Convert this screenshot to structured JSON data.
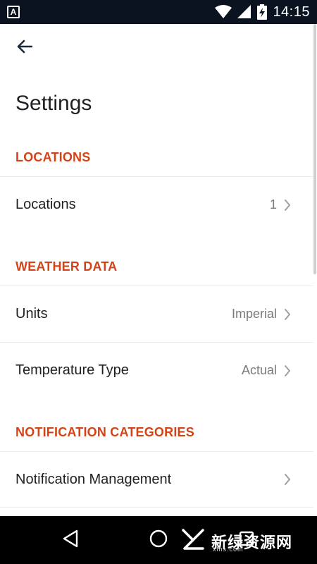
{
  "status_bar": {
    "time": "14:15",
    "app_icon_letter": "A",
    "icons": [
      "wifi-icon",
      "signal-icon",
      "battery-charging-icon"
    ]
  },
  "toolbar": {
    "back_icon": "arrow-left-icon"
  },
  "page": {
    "title": "Settings"
  },
  "sections": {
    "locations": {
      "header": "LOCATIONS",
      "rows": [
        {
          "label": "Locations",
          "value": "1"
        }
      ]
    },
    "weather_data": {
      "header": "WEATHER DATA",
      "rows": [
        {
          "label": "Units",
          "value": "Imperial"
        },
        {
          "label": "Temperature Type",
          "value": "Actual"
        }
      ]
    },
    "notification_categories": {
      "header": "NOTIFICATION CATEGORIES",
      "rows": [
        {
          "label": "Notification Management",
          "value": ""
        }
      ]
    }
  },
  "nav_bar": {
    "icons": [
      "back-triangle-icon",
      "home-circle-icon",
      "recents-square-icon"
    ]
  },
  "watermark": {
    "text": "新绿资源网",
    "sub": "xlhs.com"
  },
  "colors": {
    "accent": "#d44315",
    "status_bar": "#0b1320",
    "nav_bar": "#000000",
    "value_text": "#7a7a7a"
  }
}
